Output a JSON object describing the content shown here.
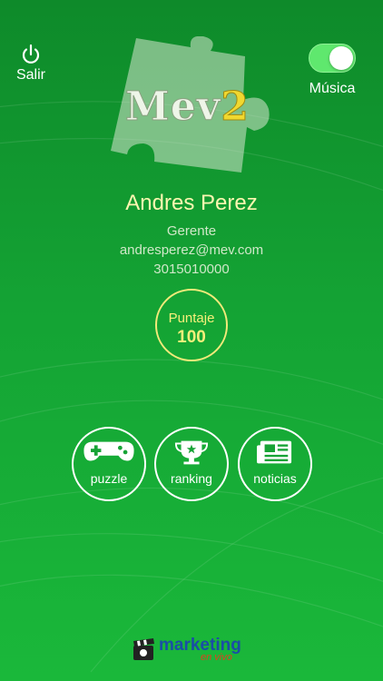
{
  "header": {
    "logout_label": "Salir",
    "music_label": "Música",
    "music_enabled": true,
    "logo_main": "Mev",
    "logo_accent": "2"
  },
  "profile": {
    "name": "Andres Perez",
    "role": "Gerente",
    "email": "andresperez@mev.com",
    "phone": "3015010000"
  },
  "score": {
    "label": "Puntaje",
    "value": "100"
  },
  "menu": {
    "items": [
      {
        "label": "puzzle",
        "icon": "gamepad-icon"
      },
      {
        "label": "ranking",
        "icon": "trophy-icon"
      },
      {
        "label": "noticias",
        "icon": "newspaper-icon"
      }
    ]
  },
  "footer": {
    "brand": "marketing",
    "sub": "en vivo"
  },
  "colors": {
    "background": "#14a334",
    "name_text": "#fbf6b0",
    "score_ring": "#f2ea7a",
    "toggle_on": "#5fe86e"
  }
}
